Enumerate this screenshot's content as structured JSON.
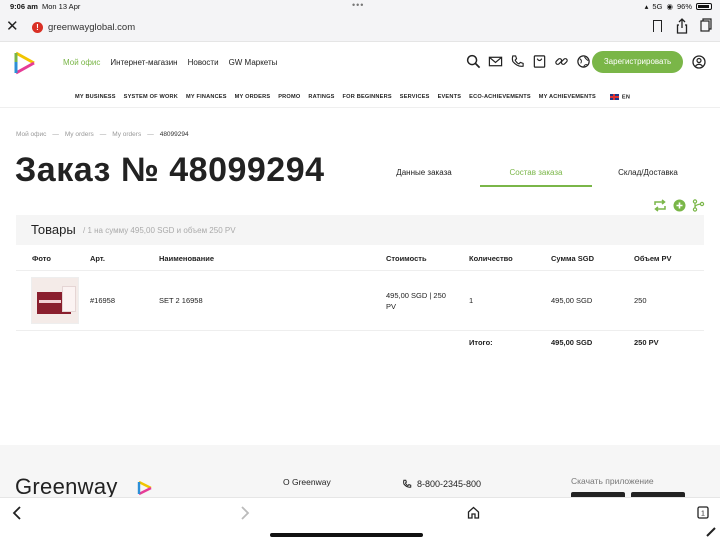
{
  "status_bar": {
    "time": "9:06 am",
    "date": "Mon 13 Apr",
    "signal": "5G",
    "battery": "96%"
  },
  "browser": {
    "url": "greenwayglobal.com"
  },
  "header": {
    "nav": [
      "Мой офис",
      "Интернет-магазин",
      "Новости",
      "GW Маркеты"
    ],
    "active_nav": 0,
    "register_label": "Зарегистрировать",
    "accent_color": "#7ab648"
  },
  "subnav": {
    "items": [
      "MY BUSINESS",
      "SYSTEM OF WORK",
      "MY FINANCES",
      "MY ORDERS",
      "PROMO",
      "RATINGS",
      "FOR BEGINNERS",
      "SERVICES",
      "EVENTS",
      "ECO-ACHIEVEMENTS",
      "MY ACHIEVEMENTS"
    ],
    "language": "EN"
  },
  "breadcrumb": [
    "Мой офис",
    "My orders",
    "My orders",
    "48099294"
  ],
  "page": {
    "title": "Заказ № 48099294"
  },
  "tabs": [
    "Данные заказа",
    "Состав заказа",
    "Склад/Доставка"
  ],
  "active_tab": 1,
  "goods": {
    "title": "Товары",
    "subtitle": "/ 1 на сумму 495,00 SGD и объем 250 PV"
  },
  "table": {
    "headers": [
      "Фото",
      "Арт.",
      "Наименование",
      "Стоимость",
      "Количество",
      "Сумма SGD",
      "Объем PV"
    ],
    "rows": [
      {
        "article": "#16958",
        "name": "SET 2 16958",
        "price_line1": "495,00 SGD | 250",
        "price_line2": "PV",
        "qty": "1",
        "sum": "495,00 SGD",
        "pv": "250"
      }
    ],
    "total_label": "Итого:",
    "total_sum": "495,00 SGD",
    "total_pv": "250 PV"
  },
  "footer": {
    "brand": "Greenway",
    "about": "О Greenway",
    "phone": "8-800-2345-800",
    "download": "Скачать приложение"
  }
}
